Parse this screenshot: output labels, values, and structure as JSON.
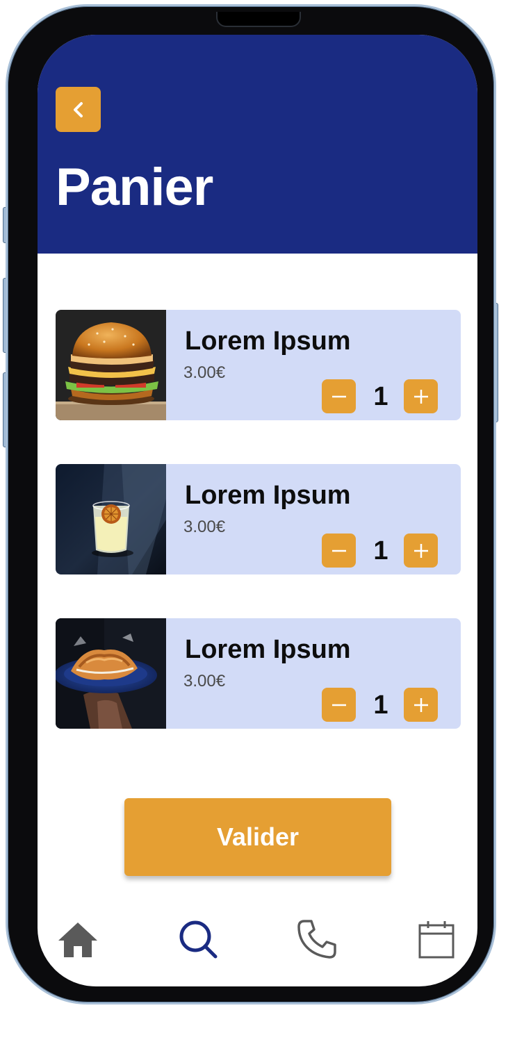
{
  "header": {
    "title": "Panier",
    "back_icon": "chevron-left-icon"
  },
  "cart": {
    "items": [
      {
        "name": "Lorem Ipsum",
        "price": "3.00€",
        "quantity": "1",
        "image": "burger-photo"
      },
      {
        "name": "Lorem Ipsum",
        "price": "3.00€",
        "quantity": "1",
        "image": "cocktail-photo"
      },
      {
        "name": "Lorem Ipsum",
        "price": "3.00€",
        "quantity": "1",
        "image": "croissant-photo"
      }
    ]
  },
  "actions": {
    "validate_label": "Valider"
  },
  "nav": {
    "items": [
      {
        "icon": "home-icon",
        "active": false
      },
      {
        "icon": "search-icon",
        "active": true
      },
      {
        "icon": "phone-icon",
        "active": false
      },
      {
        "icon": "calendar-icon",
        "active": false
      }
    ]
  },
  "colors": {
    "header_bg": "#1a2b82",
    "accent": "#e59f33",
    "card_bg": "#d2dbf7",
    "nav_active": "#1a2b82",
    "nav_inactive": "#5a5a5a"
  }
}
